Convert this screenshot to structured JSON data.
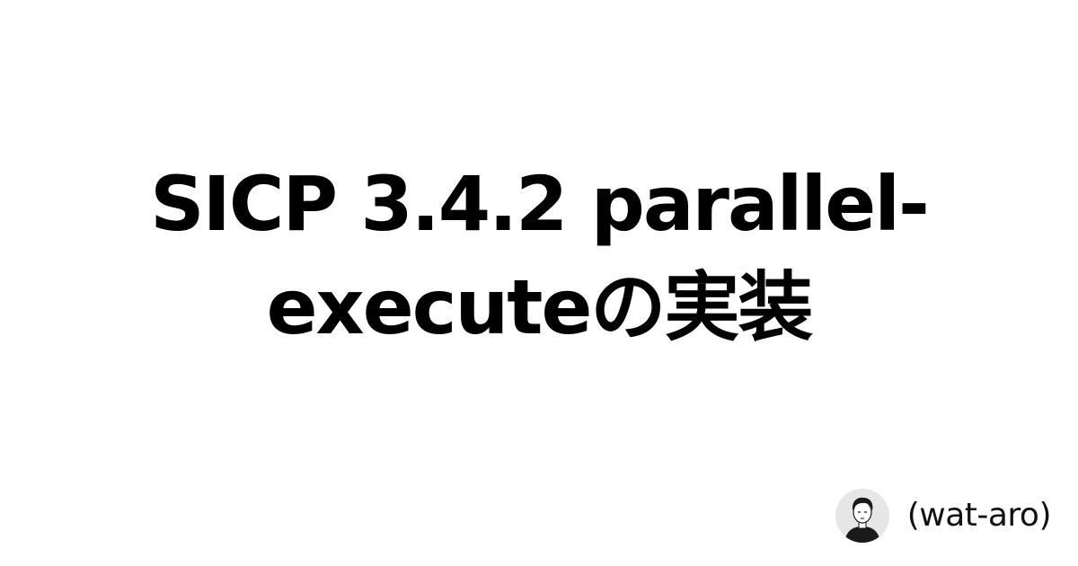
{
  "article": {
    "title": "SICP 3.4.2 parallel-executeの実装"
  },
  "author": {
    "name": "(wat-aro)",
    "avatar_icon": "user-avatar-icon"
  },
  "colors": {
    "background": "#ffffff",
    "text": "#000000"
  }
}
